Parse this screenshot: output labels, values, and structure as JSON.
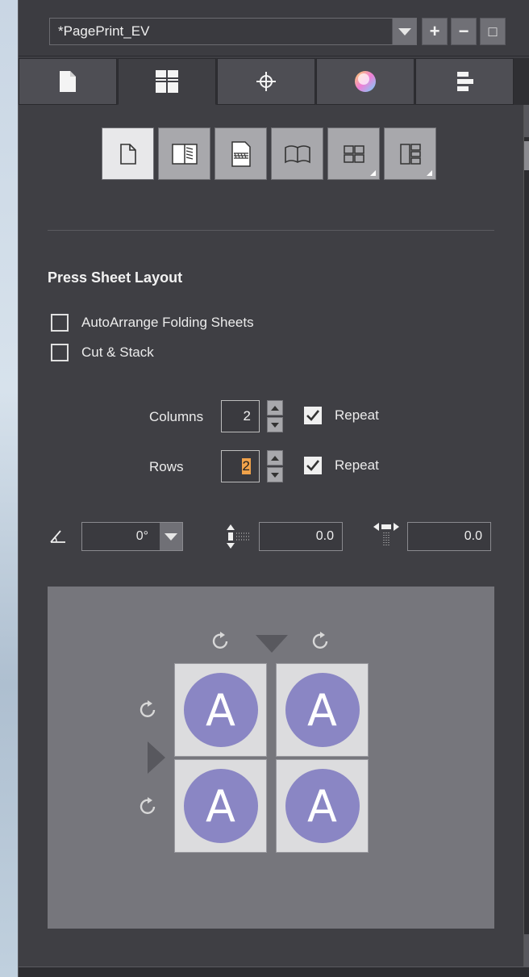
{
  "topbar": {
    "preset_value": "*PagePrint_EV",
    "add_label": "+",
    "remove_label": "−",
    "maximize_label": "□"
  },
  "tabs": [
    {
      "name": "document",
      "icon": "page-icon"
    },
    {
      "name": "layout",
      "icon": "layout-grid-icon",
      "active": true
    },
    {
      "name": "marks",
      "icon": "crosshair-icon"
    },
    {
      "name": "color",
      "icon": "color-wheel-icon"
    },
    {
      "name": "align",
      "icon": "align-icon"
    }
  ],
  "mode_buttons": [
    {
      "name": "single-page",
      "active": true
    },
    {
      "name": "folded"
    },
    {
      "name": "perfect-bound"
    },
    {
      "name": "saddle-stitch"
    },
    {
      "name": "grid-menu"
    },
    {
      "name": "columns-menu"
    }
  ],
  "section": {
    "title": "Press Sheet Layout",
    "auto_arrange_label": "AutoArrange Folding Sheets",
    "cut_stack_label": "Cut & Stack"
  },
  "grid": {
    "columns_label": "Columns",
    "columns_value": "2",
    "rows_label": "Rows",
    "rows_value": "2",
    "repeat_label": "Repeat"
  },
  "fields": {
    "rotation_value": "0°",
    "vertical_spacing_value": "0.0",
    "horizontal_spacing_value": "0.0"
  },
  "preview": {
    "tile_letter": "A",
    "accent_color": "#8a86c4"
  }
}
